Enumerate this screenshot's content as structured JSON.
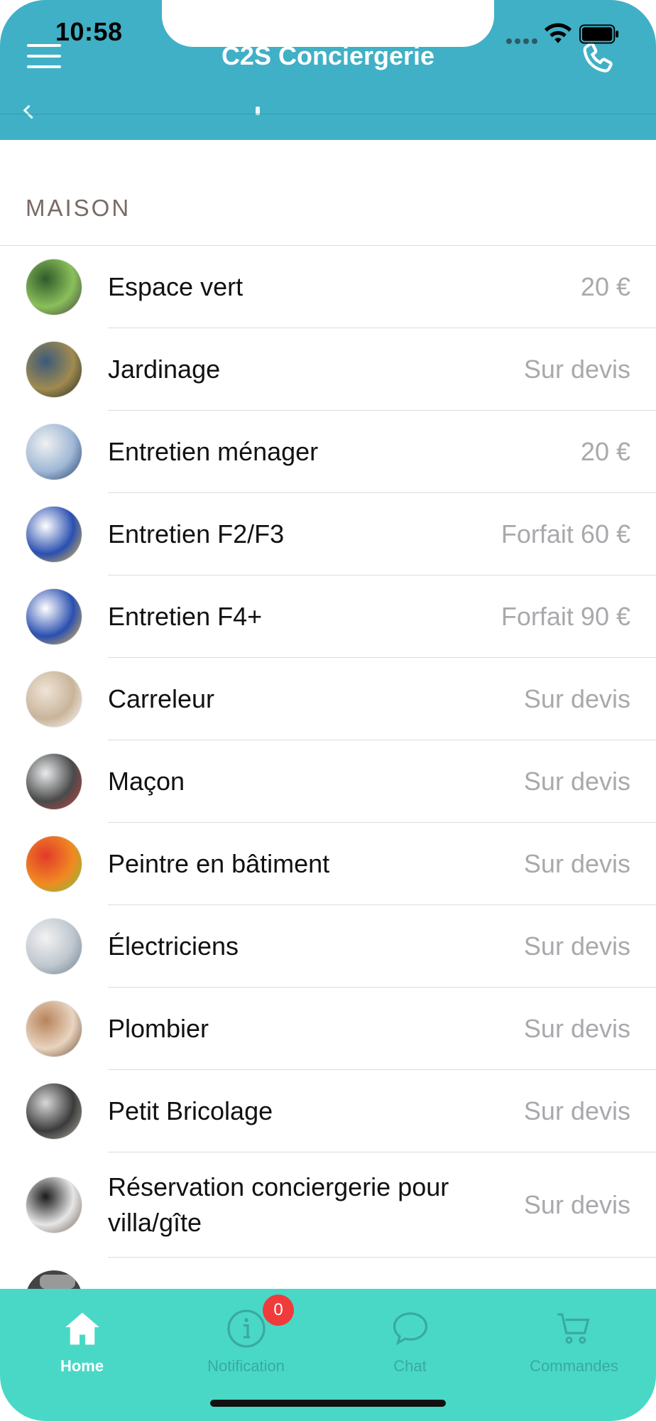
{
  "status_bar": {
    "time": "10:58"
  },
  "header": {
    "title": "C2S Conciergerie"
  },
  "section": {
    "title": "MAISON"
  },
  "services": [
    {
      "label": "Espace vert",
      "price": "20 €",
      "thumb": [
        "#2f5b2a",
        "#8bbf5a",
        "#3e3e3e"
      ]
    },
    {
      "label": "Jardinage",
      "price": "Sur devis",
      "thumb": [
        "#3b5a7a",
        "#a08a50",
        "#1e2a1e"
      ]
    },
    {
      "label": "Entretien ménager",
      "price": "20 €",
      "thumb": [
        "#f0f0f0",
        "#9fb8d6",
        "#1f3a66"
      ]
    },
    {
      "label": "Entretien F2/F3",
      "price": "Forfait 60 €",
      "thumb": [
        "#ffffff",
        "#2a4fb0",
        "#f2c44a"
      ]
    },
    {
      "label": "Entretien F4+",
      "price": "Forfait 90 €",
      "thumb": [
        "#ffffff",
        "#2a4fb0",
        "#f2c44a"
      ]
    },
    {
      "label": "Carreleur",
      "price": "Sur devis",
      "thumb": [
        "#efe4d6",
        "#c9b49a",
        "#ffffff"
      ]
    },
    {
      "label": "Maçon",
      "price": "Sur devis",
      "thumb": [
        "#e9ecee",
        "#4a4a4a",
        "#c44"
      ]
    },
    {
      "label": "Peintre en bâtiment",
      "price": "Sur devis",
      "thumb": [
        "#e23a2a",
        "#f08a22",
        "#7ac23a"
      ]
    },
    {
      "label": "Électriciens",
      "price": "Sur devis",
      "thumb": [
        "#f2f2f2",
        "#bfc7cf",
        "#6b7d8c"
      ]
    },
    {
      "label": "Plombier",
      "price": "Sur devis",
      "thumb": [
        "#b7835a",
        "#e9d4c0",
        "#6a4a2f"
      ]
    },
    {
      "label": "Petit Bricolage",
      "price": "Sur devis",
      "thumb": [
        "#d8d8d8",
        "#3b3b3b",
        "#b9b2a6"
      ]
    },
    {
      "label": "Réservation conciergerie pour villa/gîte",
      "price": "Sur devis",
      "thumb": [
        "#1a1a1a",
        "#e6e6e6",
        "#6e5a4a"
      ]
    }
  ],
  "tabbar": {
    "tabs": [
      {
        "label": "Home",
        "icon": "home-icon",
        "active": true
      },
      {
        "label": "Notification",
        "icon": "info-icon",
        "badge": "0"
      },
      {
        "label": "Chat",
        "icon": "chat-bubble-icon"
      },
      {
        "label": "Commandes",
        "icon": "cart-icon"
      }
    ]
  },
  "colors": {
    "header": "#40b0c6",
    "tabbar": "#49d8c6",
    "badge": "#f03b3b",
    "price_text": "#a9a9ad"
  }
}
